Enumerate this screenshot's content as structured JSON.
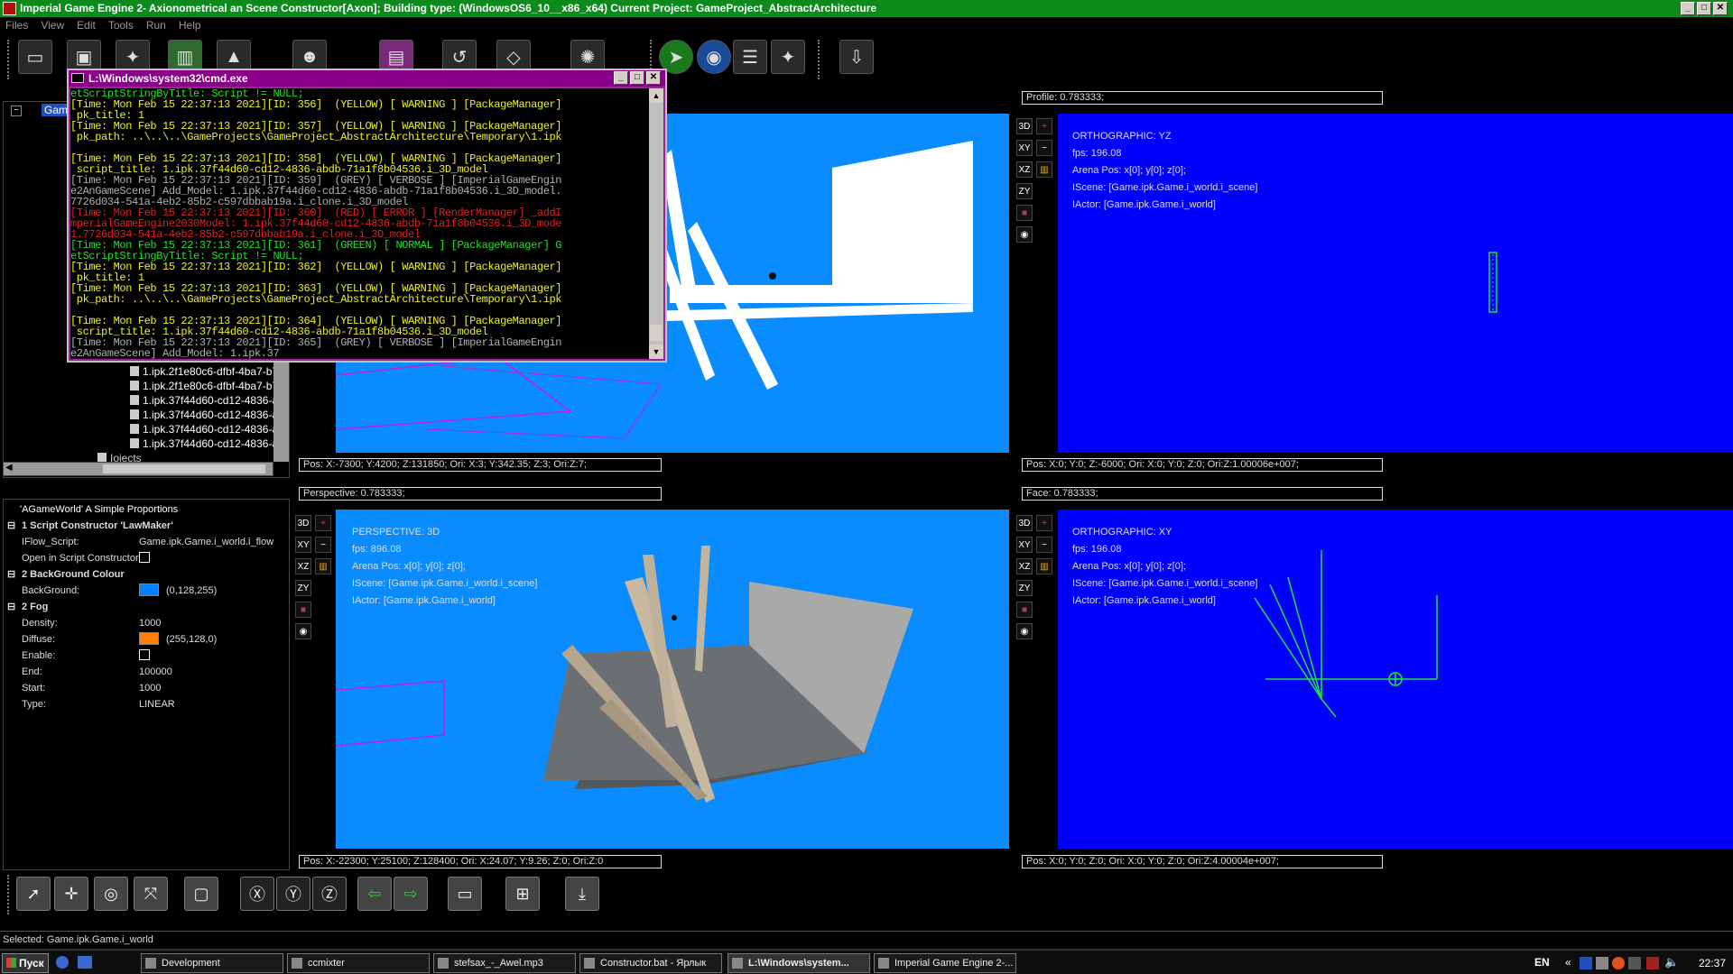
{
  "window": {
    "title": "Imperial Game Engine 2- Axionometrical an Scene Constructor[Axon]; Building type: (WindowsOS6_10__x86_x64) Current Project: GameProject_AbstractArchitecture",
    "min": "_",
    "max": "□",
    "close": "✕"
  },
  "menu": [
    "Files",
    "View",
    "Edit",
    "Tools",
    "Run",
    "Help"
  ],
  "tree": {
    "root": "Game",
    "items": [
      "1.ipk.2f1e80c6-dfbf-4ba7-b7",
      "1.ipk.2f1e80c6-dfbf-4ba7-b7",
      "1.ipk.37f44d60-cd12-4836-a",
      "1.ipk.37f44d60-cd12-4836-a",
      "1.ipk.37f44d60-cd12-4836-a",
      "1.ipk.37f44d60-cd12-4836-a"
    ],
    "folder": "Iojects"
  },
  "cmd": {
    "title": "L:\\Windows\\system32\\cmd.exe",
    "lines": [
      {
        "t": "etScriptStringByTitle: Script != NULL;",
        "c": "#22e022"
      },
      {
        "t": "[Time: Mon Feb 15 22:37:13 2021][ID: 356]  (YELLOW) [ WARNING ] [PackageManager]",
        "c": "#f0f020"
      },
      {
        "t": " pk_title: 1",
        "c": "#f0f020"
      },
      {
        "t": "[Time: Mon Feb 15 22:37:13 2021][ID: 357]  (YELLOW) [ WARNING ] [PackageManager]",
        "c": "#f0f020"
      },
      {
        "t": " pk_path: ..\\..\\..\\GameProjects\\GameProject_AbstractArchitecture\\Temporary\\1.ipk",
        "c": "#f0f020"
      },
      {
        "t": "",
        "c": "#fff"
      },
      {
        "t": "[Time: Mon Feb 15 22:37:13 2021][ID: 358]  (YELLOW) [ WARNING ] [PackageManager]",
        "c": "#f0f020"
      },
      {
        "t": " script_title: 1.ipk.37f44d60-cd12-4836-abdb-71a1f8b04536.i_3D_model",
        "c": "#f0f020"
      },
      {
        "t": "[Time: Mon Feb 15 22:37:13 2021][ID: 359]  (GREY) [ VERBOSE ] [ImperialGameEngin",
        "c": "#b0b0b0"
      },
      {
        "t": "e2AnGameScene] Add_Model: 1.ipk.37f44d60-cd12-4836-abdb-71a1f8b04536.i_3D_model.",
        "c": "#b0b0b0"
      },
      {
        "t": "7726d034-541a-4eb2-85b2-c597dbbab19a.i_clone.i_3D_model",
        "c": "#b0b0b0"
      },
      {
        "t": "[Time: Mon Feb 15 22:37:13 2021][ID: 360]  (RED) [ ERROR ] [RenderManager] _addI",
        "c": "#e02020"
      },
      {
        "t": "mperialGameEngine2030Model: 1.ipk.37f44d60-cd12-4836-abdb-71a1f8b04536.i_3D_mode",
        "c": "#e02020"
      },
      {
        "t": "1.7726d034-541a-4eb2-85b2-c597dbbab19a.i_clone.i_3D_model",
        "c": "#e02020"
      },
      {
        "t": "[Time: Mon Feb 15 22:37:13 2021][ID: 361]  (GREEN) [ NORMAL ] [PackageManager] G",
        "c": "#22e022"
      },
      {
        "t": "etScriptStringByTitle: Script != NULL;",
        "c": "#22e022"
      },
      {
        "t": "[Time: Mon Feb 15 22:37:13 2021][ID: 362]  (YELLOW) [ WARNING ] [PackageManager]",
        "c": "#f0f020"
      },
      {
        "t": " pk_title: 1",
        "c": "#f0f020"
      },
      {
        "t": "[Time: Mon Feb 15 22:37:13 2021][ID: 363]  (YELLOW) [ WARNING ] [PackageManager]",
        "c": "#f0f020"
      },
      {
        "t": " pk_path: ..\\..\\..\\GameProjects\\GameProject_AbstractArchitecture\\Temporary\\1.ipk",
        "c": "#f0f020"
      },
      {
        "t": "",
        "c": "#fff"
      },
      {
        "t": "[Time: Mon Feb 15 22:37:13 2021][ID: 364]  (YELLOW) [ WARNING ] [PackageManager]",
        "c": "#f0f020"
      },
      {
        "t": " script_title: 1.ipk.37f44d60-cd12-4836-abdb-71a1f8b04536.i_3D_model",
        "c": "#f0f020"
      },
      {
        "t": "[Time: Mon Feb 15 22:37:13 2021][ID: 365]  (GREY) [ VERBOSE ] [ImperialGameEngin",
        "c": "#b0b0b0"
      },
      {
        "t": "e2AnGameScene] Add_Model: 1.ipk.37",
        "c": "#b0b0b0"
      }
    ]
  },
  "properties": {
    "header": "'AGameWorld' A Simple Proportions",
    "rows": [
      {
        "key": "1 Script Constructor 'LawMaker'",
        "val": "",
        "type": "section"
      },
      {
        "key": "IFlow_Script:",
        "val": "Game.ipk.Game.i_world.i_flow",
        "type": "text"
      },
      {
        "key": "Open in Script Constructor",
        "val": "",
        "type": "check"
      },
      {
        "key": "2 BackGround Colour",
        "val": "",
        "type": "section"
      },
      {
        "key": "BackGround:",
        "val": "(0,128,255)",
        "type": "color",
        "color": "#0080ff"
      },
      {
        "key": "2 Fog",
        "val": "",
        "type": "section"
      },
      {
        "key": "Density:",
        "val": "1000",
        "type": "text"
      },
      {
        "key": "Diffuse:",
        "val": "(255,128,0)",
        "type": "color",
        "color": "#ff8000"
      },
      {
        "key": "Enable:",
        "val": "",
        "type": "check"
      },
      {
        "key": "End:",
        "val": "100000",
        "type": "text"
      },
      {
        "key": "Start:",
        "val": "1000",
        "type": "text"
      },
      {
        "key": "Type:",
        "val": "LINEAR",
        "type": "text"
      }
    ]
  },
  "viewports": {
    "top_left": {
      "header": "",
      "footer": "Pos: X:-7300; Y:4200; Z:131850; Ori: X:3; Y:342.35; Z:3; Ori:Z:7;"
    },
    "top_right": {
      "header": "Profile: 0.783333;",
      "footer": "Pos: X:0; Y:0; Z:-6000; Ori: X:0; Y:0; Z:0; Ori:Z:1.00006e+007;",
      "info": [
        "ORTHOGRAPHIC: YZ",
        "fps: 196.08",
        "Arena Pos: x[0]; y[0]; z[0];",
        "IScene: [Game.ipk.Game.i_world.i_scene]",
        "IActor: [Game.ipk.Game.i_world]"
      ]
    },
    "bottom_left": {
      "header": "Perspective: 0.783333;",
      "footer": "Pos: X:-22300; Y:25100; Z:128400; Ori: X:24.07; Y:9.26; Z:0; Ori:Z:0",
      "info": [
        "PERSPECTIVE: 3D",
        "fps: 896.08",
        "Arena Pos: x[0]; y[0]; z[0];",
        "IScene: [Game.ipk.Game.i_world.i_scene]",
        "IActor: [Game.ipk.Game.i_world]"
      ]
    },
    "bottom_right": {
      "header": "Face: 0.783333;",
      "footer": "Pos: X:0; Y:0; Z:0; Ori: X:0; Y:0; Z:0; Ori:Z:4.00004e+007;",
      "info": [
        "ORTHOGRAPHIC: XY",
        "fps: 196.08",
        "Arena Pos: x[0]; y[0]; z[0];",
        "IScene: [Game.ipk.Game.i_world.i_scene]",
        "IActor: [Game.ipk.Game.i_world]"
      ]
    },
    "tools": [
      "3D",
      "XY",
      "XZ",
      "ZY"
    ]
  },
  "status": "Selected: Game.ipk.Game.i_world",
  "taskbar": {
    "start": "Пуск",
    "tasks": [
      "Development",
      "ccmixter",
      "stefsax_-_Awel.mp3",
      "Constructor.bat - Ярлык",
      "L:\\Windows\\system...",
      "Imperial Game Engine 2-..."
    ],
    "lang": "EN",
    "clock": "22:37"
  },
  "colors": {
    "title_green": "#0c8a1c",
    "viewport_sky": "#0a8cff",
    "viewport_ortho": "#0000ff"
  }
}
